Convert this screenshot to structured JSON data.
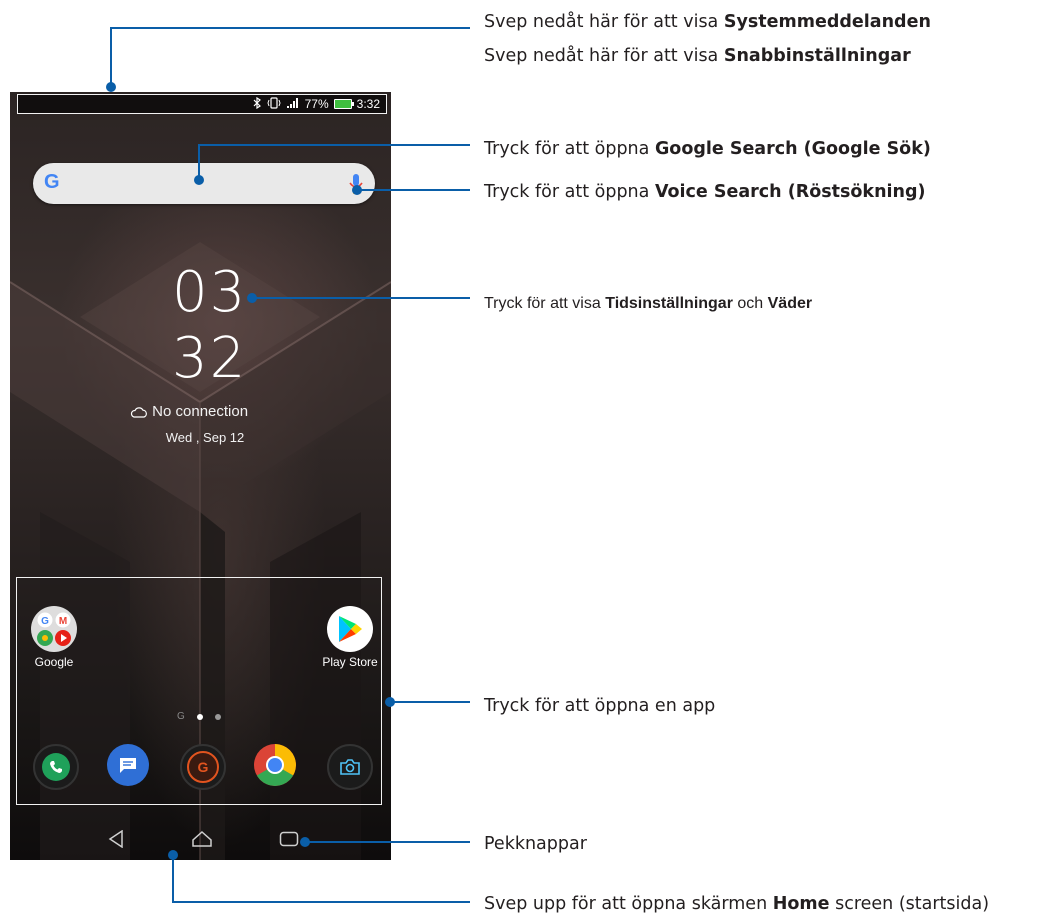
{
  "status_bar": {
    "bluetooth_icon": "bluetooth-icon",
    "vibrate_icon": "vibrate-icon",
    "signal_icon": "signal-icon",
    "battery_percent": "77%",
    "battery_level": 0.77,
    "time": "3:32"
  },
  "search": {
    "logo": "G",
    "logo_color": "#4285f4",
    "mic_color": "#4285f4"
  },
  "clock": {
    "hours": "03",
    "minutes": "32"
  },
  "weather": {
    "icon": "cloud-icon",
    "text": "No connection"
  },
  "date": "Wed , Sep 12",
  "home_apps": [
    {
      "label": "Google",
      "icon": "google-folder-icon"
    },
    {
      "label": "Play Store",
      "icon": "play-store-icon"
    }
  ],
  "page_indicator": {
    "g_label": "G",
    "active_index": 1,
    "count": 2
  },
  "dock": [
    {
      "name": "phone",
      "icon": "phone-icon",
      "color": "#1fa15a"
    },
    {
      "name": "messages",
      "icon": "messages-icon",
      "color": "#2f6fd6"
    },
    {
      "name": "game-center",
      "icon": "game-center-icon",
      "color": "#e2541f"
    },
    {
      "name": "chrome",
      "icon": "chrome-icon",
      "color": "#db4437"
    },
    {
      "name": "camera",
      "icon": "camera-icon",
      "color": "#4fc3f7"
    }
  ],
  "nav": [
    "back-icon",
    "home-icon",
    "recents-icon"
  ],
  "callouts": {
    "notif_line1_prefix": "Svep nedåt här för att visa ",
    "notif_line1_bold": "Systemmeddelanden",
    "notif_line2_prefix": "Svep nedåt här för att visa ",
    "notif_line2_bold": "Snabbinställningar",
    "search_prefix": "Tryck för att öppna ",
    "search_bold": "Google Search (Google Sök)",
    "voice_prefix": "Tryck för att öppna ",
    "voice_bold": "Voice Search (Röstsökning)",
    "time_prefix": "Tryck för att visa ",
    "time_bold1": "Tidsinställningar",
    "time_mid": " och ",
    "time_bold2": "Väder",
    "app": "Tryck för att öppna en app",
    "keys": "Pekknappar",
    "home_prefix": "Svep upp för att öppna skärmen ",
    "home_bold": "Home",
    "home_suffix": " screen (startsida)"
  },
  "colors": {
    "callout_line": "#0a5ea8",
    "text": "#231f20"
  }
}
